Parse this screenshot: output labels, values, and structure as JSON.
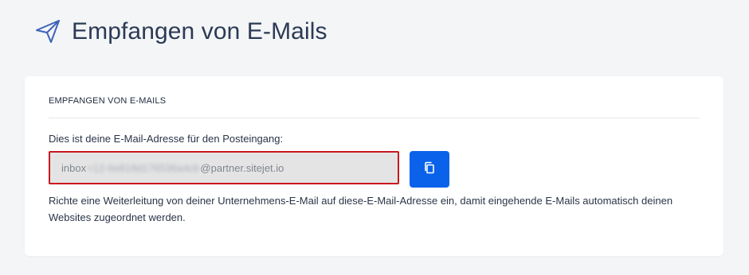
{
  "page": {
    "title": "Empfangen von E-Mails",
    "icon": "paper-plane-icon"
  },
  "card": {
    "title": "EMPFANGEN VON E-MAILS",
    "field_label": "Dies ist deine E-Mail-Adresse für den Posteingang:",
    "email": {
      "prefix": "inbox",
      "redacted": "+12-6e818d176536a4cb",
      "domain": "@partner.sitejet.io"
    },
    "copy_button": {
      "icon": "copy-icon"
    },
    "help_text": "Richte eine Weiterleitung von deiner Unternehmens-E-Mail auf diese-E-Mail-Adresse ein, damit eingehende E-Mails automatisch deinen Websites zugeordnet werden."
  },
  "colors": {
    "background": "#f4f5f7",
    "card": "#ffffff",
    "accent": "#0a62ea",
    "error_border": "#c8181e",
    "title": "#2b3a55",
    "icon": "#3b63b7"
  }
}
